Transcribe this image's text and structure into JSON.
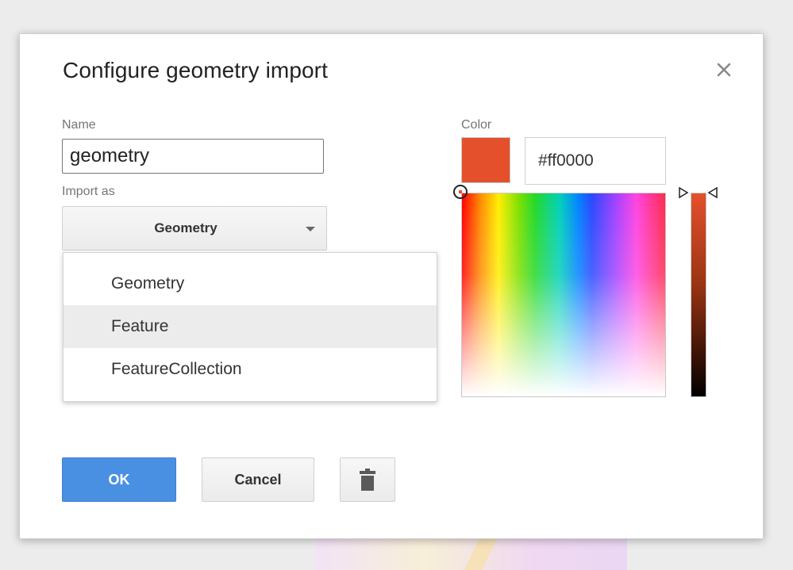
{
  "dialog": {
    "title": "Configure geometry import",
    "close_icon": "close-icon"
  },
  "name_field": {
    "label": "Name",
    "value": "geometry"
  },
  "import_as": {
    "label": "Import as",
    "selected": "Geometry",
    "options": [
      "Geometry",
      "Feature",
      "FeatureCollection"
    ],
    "highlighted_option": "Feature"
  },
  "color": {
    "label": "Color",
    "hex_value": "#ff0000",
    "swatch_color": "#e4502b"
  },
  "buttons": {
    "ok": "OK",
    "cancel": "Cancel",
    "delete_icon": "trash-icon"
  }
}
